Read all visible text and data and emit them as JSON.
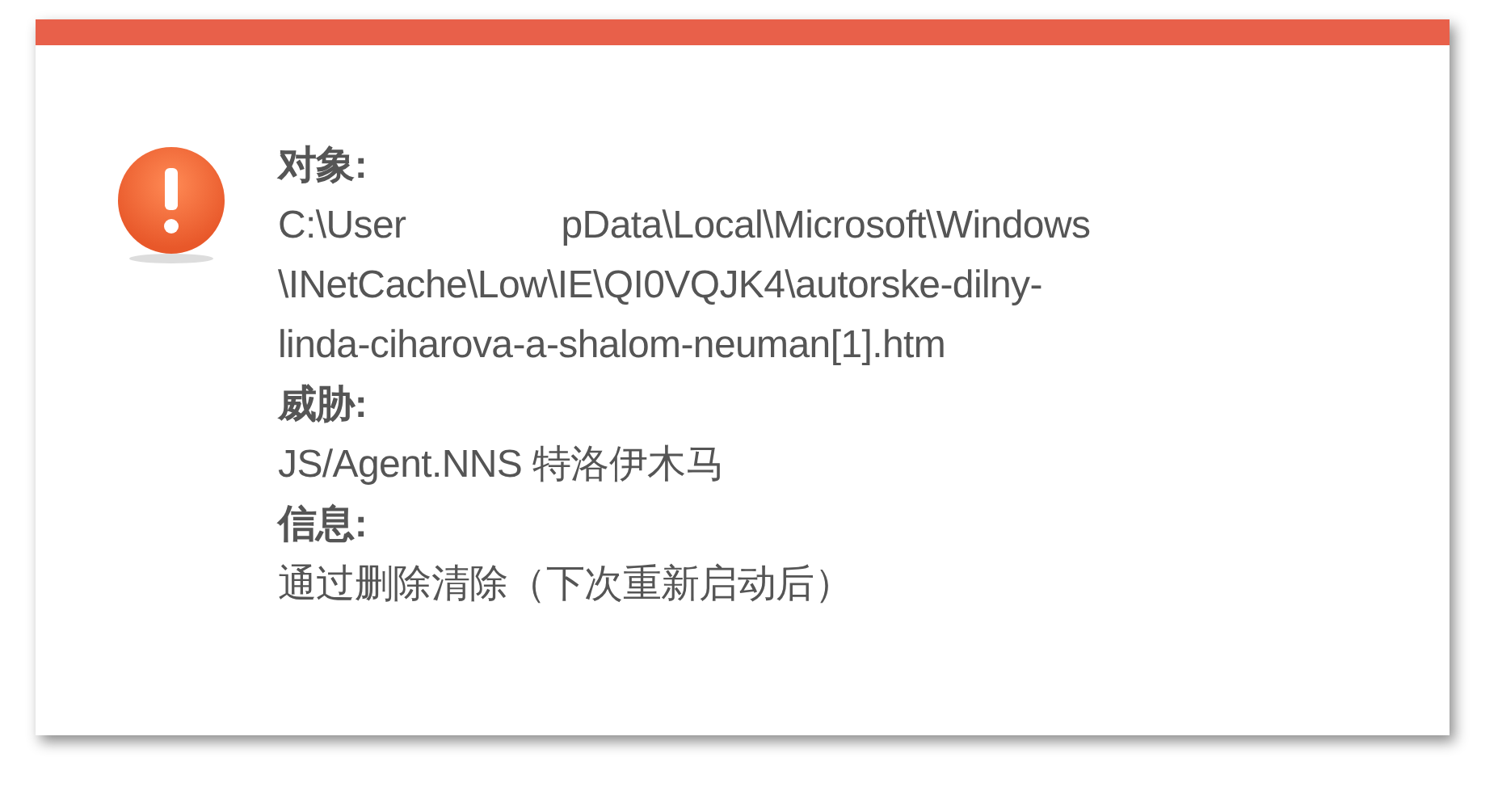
{
  "alert": {
    "kind": "warning",
    "fields": [
      {
        "label": "对象:",
        "lines": [
          [
            "C:\\User",
            "pData\\Local\\Microsoft\\Windows"
          ],
          [
            "\\INetCache\\Low\\IE\\QI0VQJK4\\autorske-dilny-"
          ],
          [
            "linda-ciharova-a-shalom-neuman[1].htm"
          ]
        ]
      },
      {
        "label": "威胁:",
        "lines": [
          [
            "JS/Agent.NNS 特洛伊木马"
          ]
        ]
      },
      {
        "label": "信息:",
        "lines": [
          [
            "通过删除清除（下次重新启动后）"
          ]
        ]
      }
    ]
  }
}
